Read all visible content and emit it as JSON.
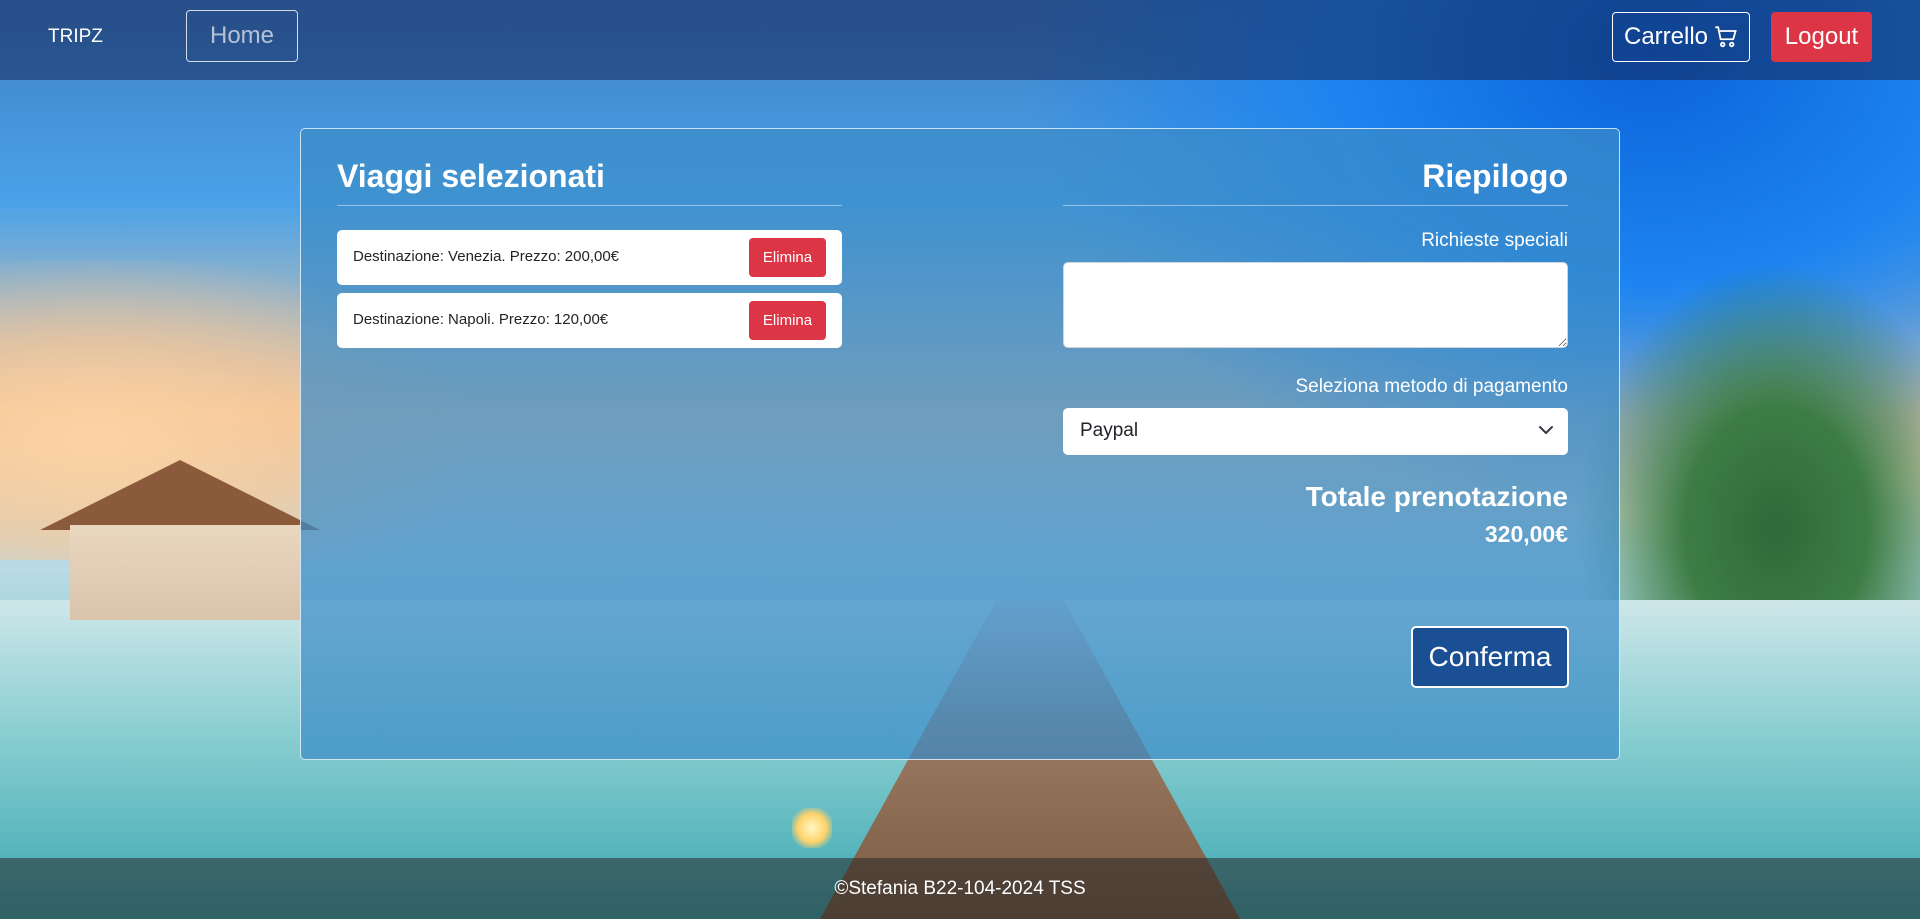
{
  "navbar": {
    "brand": "TRIPZ",
    "home_label": "Home",
    "cart_label": "Carrello",
    "cart_icon": "cart-icon",
    "logout_label": "Logout"
  },
  "selected_trips": {
    "title": "Viaggi selezionati",
    "items": [
      {
        "text": "Destinazione: Venezia. Prezzo: 200,00€",
        "delete_label": "Elimina"
      },
      {
        "text": "Destinazione: Napoli. Prezzo: 120,00€",
        "delete_label": "Elimina"
      }
    ]
  },
  "summary": {
    "title": "Riepilogo",
    "special_requests_label": "Richieste speciali",
    "special_requests_value": "",
    "payment_label": "Seleziona metodo di pagamento",
    "payment_selected": "Paypal",
    "total_label": "Totale prenotazione",
    "total_value": "320,00€",
    "confirm_label": "Conferma"
  },
  "footer": {
    "text": "©Stefania B22-104-2024 TSS"
  },
  "colors": {
    "danger": "#dc3545",
    "confirm_bg": "#1b4f94",
    "panel_bg": "rgba(60,140,200,0.72)"
  }
}
